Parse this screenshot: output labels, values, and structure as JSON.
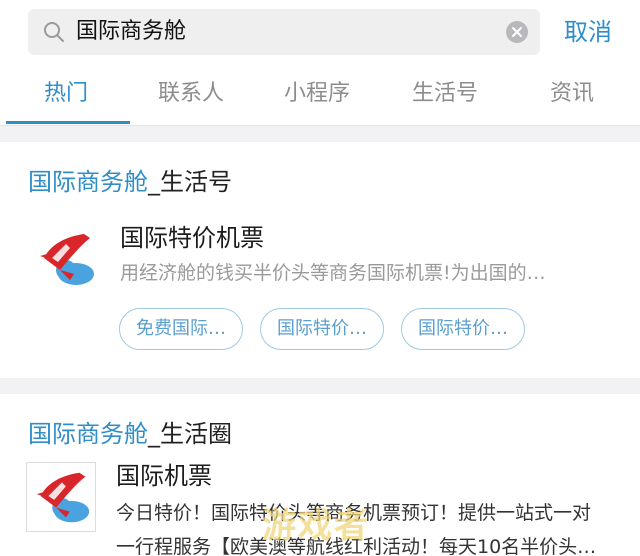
{
  "search": {
    "query": "国际商务舱",
    "cancel_label": "取消"
  },
  "tabs": [
    {
      "label": "热门",
      "active": true
    },
    {
      "label": "联系人",
      "active": false
    },
    {
      "label": "小程序",
      "active": false
    },
    {
      "label": "生活号",
      "active": false
    },
    {
      "label": "资讯",
      "active": false
    }
  ],
  "sections": [
    {
      "title_highlight": "国际商务舱",
      "title_suffix": "_生活号",
      "item": {
        "title": "国际特价机票",
        "desc": "用经济舱的钱买半价头等商务国际机票!为出国的…",
        "tags": [
          "免费国际…",
          "国际特价…",
          "国际特价…"
        ]
      }
    },
    {
      "title_highlight": "国际商务舱",
      "title_suffix": "_生活圈",
      "item": {
        "title": "国际机票",
        "desc_line1": "今日特价！国际特价头等商务机票预订！提供一站式一对",
        "desc_line2": "一行程服务【欧美澳等航线红利活动！每天10名半价头…"
      }
    }
  ],
  "watermark": "游戏者",
  "colors": {
    "accent": "#2f8ec8",
    "chip_border": "#9ec9e3",
    "background_gap": "#f2f2f4",
    "logo_red": "#d8262b",
    "logo_blue": "#4aa3df"
  }
}
